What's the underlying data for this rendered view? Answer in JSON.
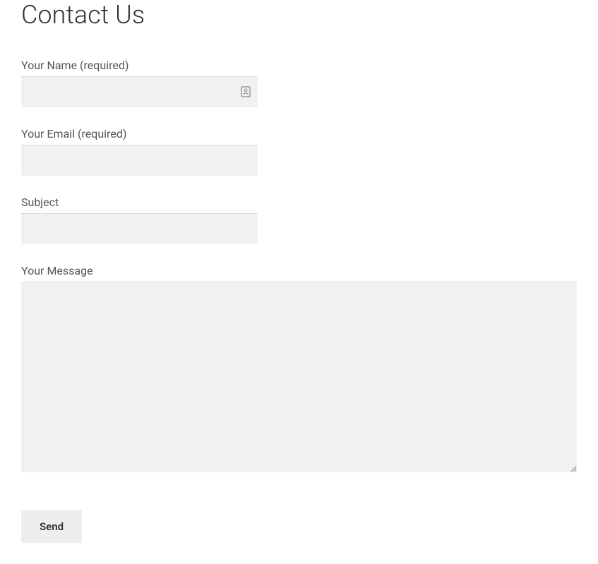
{
  "page": {
    "title": "Contact Us"
  },
  "form": {
    "name": {
      "label": "Your Name (required)",
      "value": ""
    },
    "email": {
      "label": "Your Email (required)",
      "value": ""
    },
    "subject": {
      "label": "Subject",
      "value": ""
    },
    "message": {
      "label": "Your Message",
      "value": ""
    },
    "submit_label": "Send"
  }
}
